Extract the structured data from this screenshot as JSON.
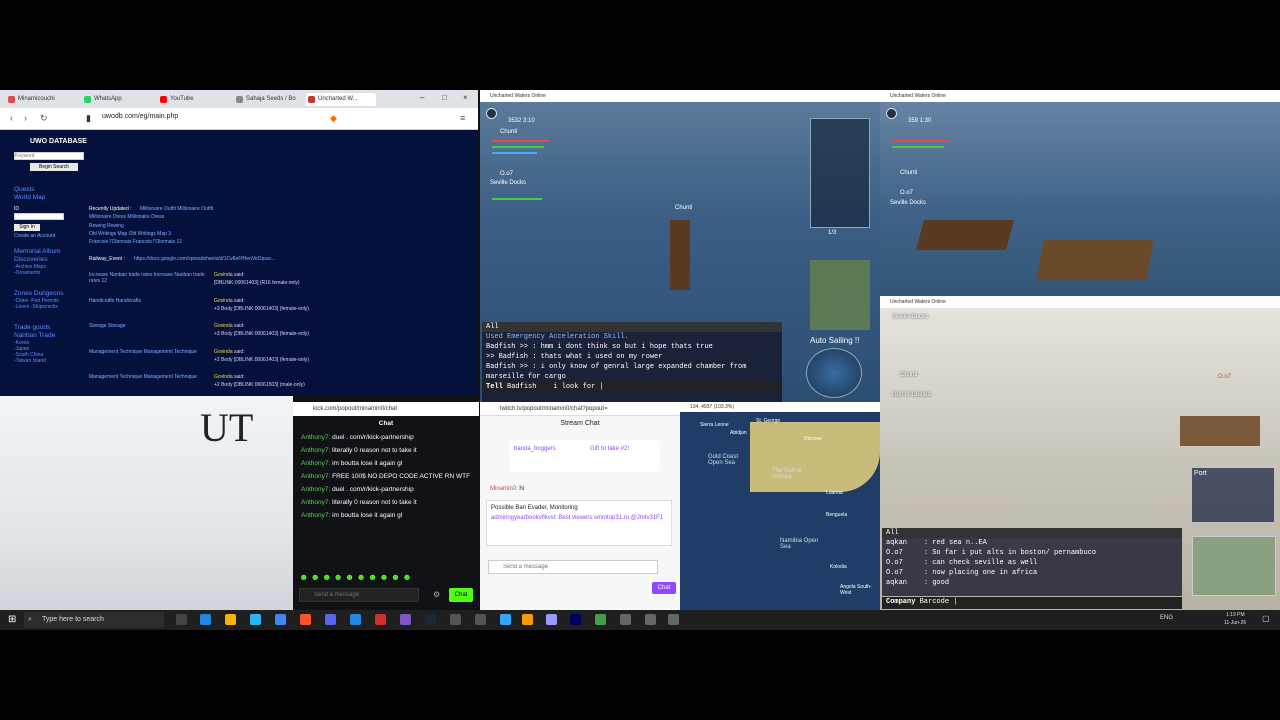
{
  "browser": {
    "tabs": [
      {
        "label": "Minamicouchi",
        "color": "#e64646"
      },
      {
        "label": "WhatsApp",
        "color": "#25d366"
      },
      {
        "label": "YouTube",
        "color": "#ff0000"
      },
      {
        "label": "Sahaja Seeds / Bo",
        "color": "#888"
      },
      {
        "label": "Uncharted W...",
        "color": "#cc3333"
      }
    ],
    "url": "uwodb.com/eg/main.php"
  },
  "uwo": {
    "logo": "UWO DATABASE",
    "search_placeholder": "Keyword",
    "search_button": "Begin Search",
    "nav1": [
      "Quests",
      "World Map"
    ],
    "id_label": "ID",
    "sign_in": "Sign In",
    "create_account": "Create an Account",
    "nav2": [
      "Memorial Album",
      "Discoveries",
      "-Archive Maps",
      "-Ornaments"
    ],
    "nav3": [
      "Zones Dungeons",
      "-Cities -Port Permits",
      "-Liners -Shipwrecks"
    ],
    "nav4": [
      "Trade goods",
      "Nanban Trade",
      "-Korea",
      "-Japan",
      "-South China",
      "-Taiwan Island"
    ],
    "recently_updated": "Recently Updated :",
    "recent": [
      "Millionaire Outfit Millionaire Outfit",
      "Millionaire Dress Millionaire Dress",
      "Rowing Rowing",
      "Old Writings Map Old Writings Map 3",
      "Francois l'Olonnais Francois l'Olonnais 12"
    ],
    "railway_event_label": "Railway_Event :",
    "railway_event_url": "https://docs.google.com/spreadsheets/d/1Cv8eFfHenVeOpuw...",
    "left_items": [
      "Increase Nanban trade rates Increase Nanban trade rates 12",
      "Handicrafts Handicrafts",
      "Storage Storage",
      "Management Technique Management Technique",
      "Management Technique Management Technique"
    ],
    "posts": [
      {
        "user": "Govinda",
        "said": "said:",
        "text": "[DBLINK:00061403] (R16 female-only)"
      },
      {
        "user": "Govinda",
        "said": "said:",
        "text": "+3 Body [DBLINK:00061403] (female-only)"
      },
      {
        "user": "Govinda",
        "said": "said:",
        "text": "+3 Body [DBLINK:00061403] (female-only)"
      },
      {
        "user": "Govinda",
        "said": "said:",
        "text": "+2 Body [DBLINK:00061403] (female-only)"
      },
      {
        "user": "Govinda",
        "said": "said:",
        "text": "+2 Body [DBLINK:00061503] (male-only)"
      }
    ]
  },
  "game1": {
    "title": "Uncharted Waters Online",
    "coords": "3532 3:10",
    "player": "Chunti",
    "crew": "O.o7",
    "location": "Seville Docks",
    "ship_label": "Chunti",
    "page": "1/3",
    "chat_tab": "All",
    "chat_lines": [
      {
        "name": "Used Emergency Acceleration Skill.",
        "text": ""
      },
      {
        "name": "Badfish >>",
        "text": ": hmm i dont think so but i hope thats true"
      },
      {
        "name": ">> Badfish",
        "text": ": thats what i used on my rower"
      },
      {
        "name": "Badfish >>",
        "text": ": i only know of genral large expanded chamber from"
      },
      {
        "name": "",
        "text": "  marseille for cargo"
      }
    ],
    "tell_label": "Tell",
    "tell_target": "Badfish",
    "tell_input": "i look for |",
    "auto_sail": "Auto Sailing !!"
  },
  "game2": {
    "title": "Uncharted Waters Online",
    "coords": "359 1:30",
    "player": "Chunti",
    "crew": "O.o7",
    "location": "Seville Docks"
  },
  "game3": {
    "title": "Uncharted Waters Online",
    "location": "Seville Docks",
    "player": "Chunti",
    "crew": "O.o7",
    "sea": "Gulf of Guinea",
    "port_label": "Port",
    "chat_tab": "All",
    "chat_lines": [
      {
        "name": "aqkan",
        "text": ": red sea n..EA"
      },
      {
        "name": "O.o7",
        "text": ": So far i put alts in boston/ pernambuco"
      },
      {
        "name": "O.o7",
        "text": ": can check seville as well"
      },
      {
        "name": "O.o7",
        "text": ": now placing one in africa"
      },
      {
        "name": "aqkan",
        "text": ": good"
      }
    ],
    "company_label": "Company",
    "company_input": "Barcode |"
  },
  "kick": {
    "url": "kick.com/popout/minamin0/chat",
    "header": "Chat",
    "messages": [
      {
        "user": "Anthony7:",
        "text": "duel . com/r/kick-partnership"
      },
      {
        "user": "Anthony7:",
        "text": "literally 0 reason not to take it"
      },
      {
        "user": "Anthony7:",
        "text": "im boutta lose it again gl"
      },
      {
        "user": "Anthony7:",
        "text": "FREE 100$ NO DEPO CODE ACTIVE RN WTF"
      },
      {
        "user": "Anthony7:",
        "text": "duel . com/r/kick-partnership"
      },
      {
        "user": "Anthony7:",
        "text": "literally 0 reason not to take it"
      },
      {
        "user": "Anthony7:",
        "text": "im boutta lose it again gl"
      }
    ],
    "input_placeholder": "Send a message",
    "chat_button": "Chat"
  },
  "twitch": {
    "url": "twitch.tv/popout/minamin0/chat?popout=",
    "header": "Stream Chat",
    "gift_user": "banda_boggers",
    "gift_text": "Gift to take #2!",
    "msg_user": "Minamin0:",
    "msg_text": "hi",
    "evader_title": "Possible Ban Evader, Monitoring",
    "evader_text": "admiringyearbookvflkvsl: Best viewers smmtop31.ru @Jmtv31F1",
    "input_placeholder": "Send a message",
    "chat_button": "Chat"
  },
  "map": {
    "title": "134, 4937 (103.3%)",
    "labels": [
      "St. George",
      "Sierra Leone",
      "Abidjan",
      "Dixcove",
      "Gold Coast Open Sea",
      "The Gulf of Guinea",
      "Luanda",
      "Benguela",
      "Namibia Open Sea",
      "Kolodia",
      "Angola South-West"
    ]
  },
  "taskbar": {
    "search_placeholder": "Type here to search",
    "lang": "ENG",
    "time": "1:19 PM",
    "date": "11-Jun-26"
  },
  "colors": {
    "game_sea": "#3d5f85",
    "uwo_bg": "#05113d",
    "kick_green": "#53fc18",
    "twitch_purple": "#9146ff"
  }
}
